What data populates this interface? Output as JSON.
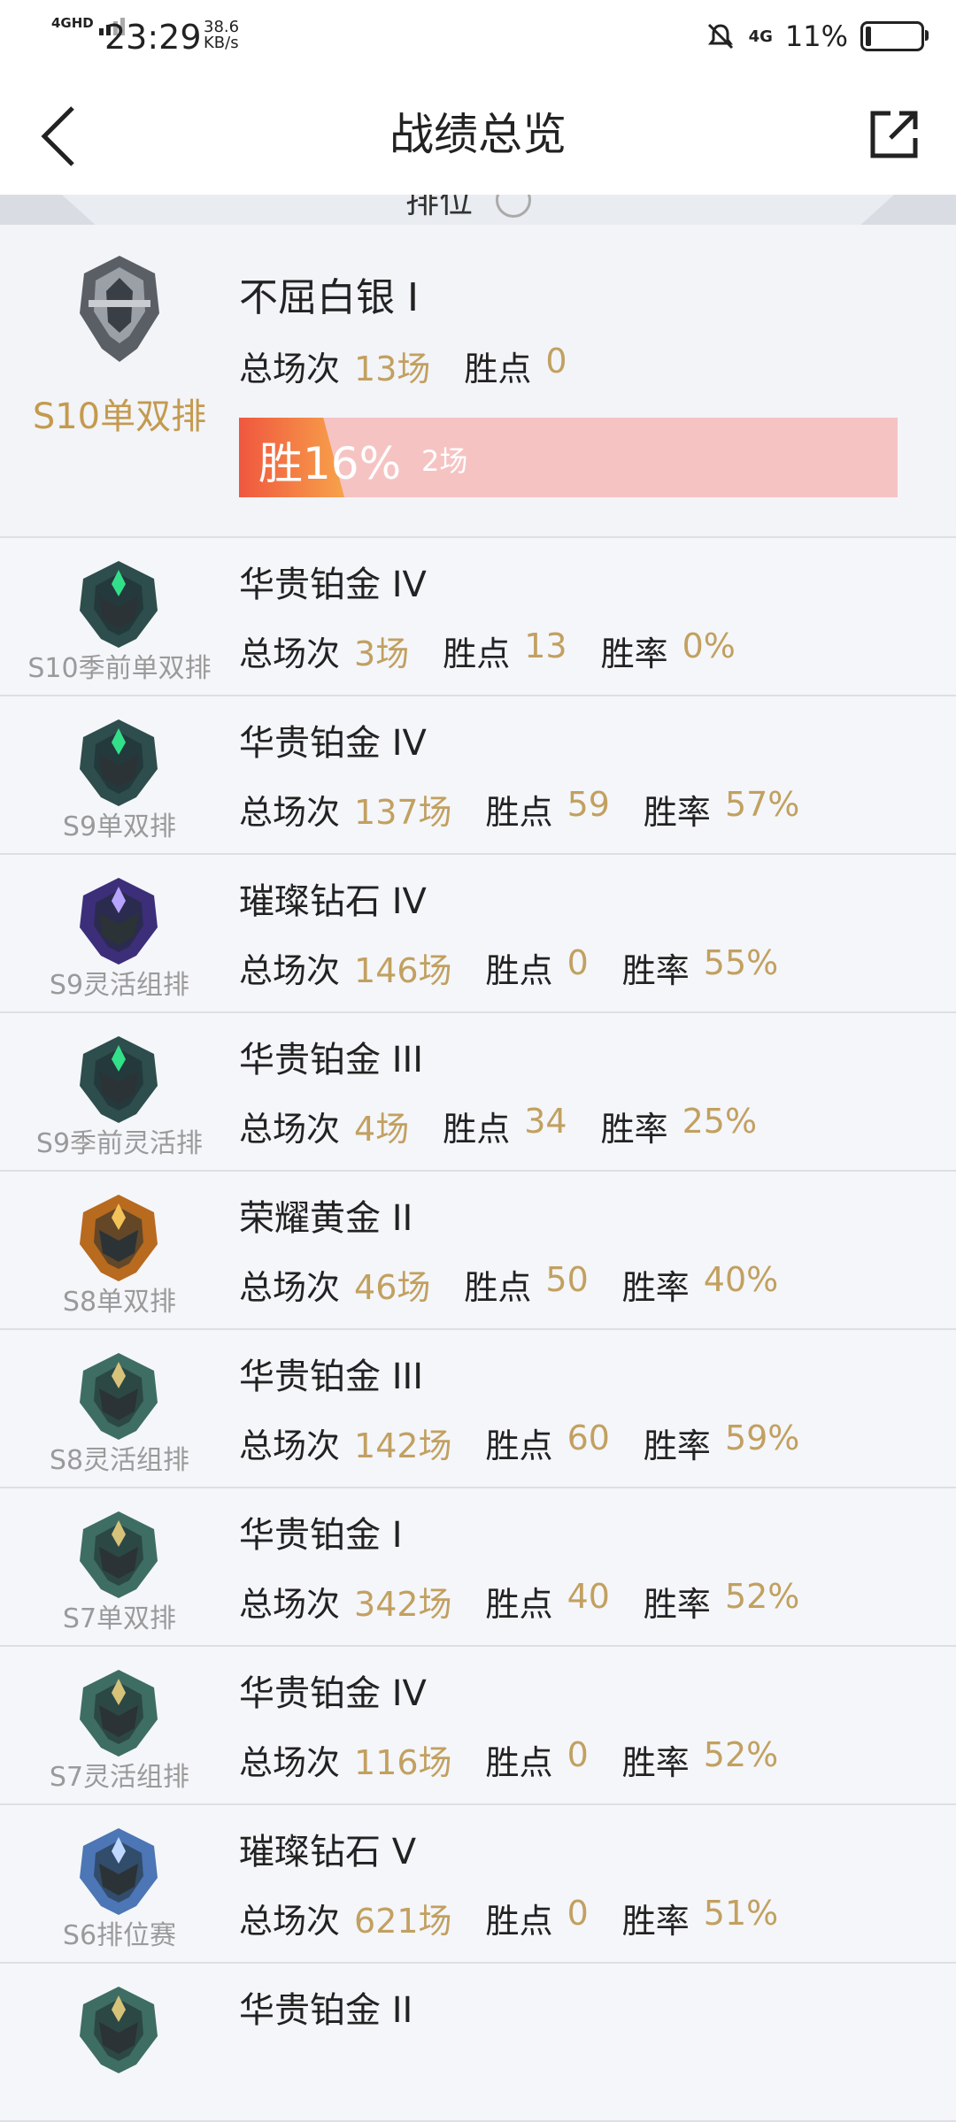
{
  "status_bar": {
    "network": "4GHD",
    "time": "23:29",
    "speed_value": "38.6",
    "speed_unit": "KB/s",
    "network2": "4G",
    "battery": "11%",
    "battery_level": 0.11
  },
  "header": {
    "title": "战绩总览",
    "back_icon": "back-arrow-icon",
    "share_icon": "share-external-icon"
  },
  "tab": {
    "label": "排位"
  },
  "current": {
    "season": "S10单双排",
    "rank": "不屈白银 I",
    "total_label": "总场次",
    "total_value": "13场",
    "lp_label": "胜点",
    "lp_value": "0",
    "win_text": "胜16%",
    "win_games": "2场",
    "win_rate": 0.16,
    "emblem_color": "#5a5f66"
  },
  "seasons": [
    {
      "season": "S10季前单双排",
      "rank": "华贵铂金 IV",
      "total_label": "总场次",
      "total": "3场",
      "lp_label": "胜点",
      "lp": "13",
      "rate_label": "胜率",
      "rate": "0%",
      "emblem": "#2e4d4d",
      "glow": "#32e08a"
    },
    {
      "season": "S9单双排",
      "rank": "华贵铂金 IV",
      "total_label": "总场次",
      "total": "137场",
      "lp_label": "胜点",
      "lp": "59",
      "rate_label": "胜率",
      "rate": "57%",
      "emblem": "#2e4d4d",
      "glow": "#32e08a"
    },
    {
      "season": "S9灵活组排",
      "rank": "璀璨钻石 IV",
      "total_label": "总场次",
      "total": "146场",
      "lp_label": "胜点",
      "lp": "0",
      "rate_label": "胜率",
      "rate": "55%",
      "emblem": "#3d2e7a",
      "glow": "#b7a4ff"
    },
    {
      "season": "S9季前灵活排",
      "rank": "华贵铂金 III",
      "total_label": "总场次",
      "total": "4场",
      "lp_label": "胜点",
      "lp": "34",
      "rate_label": "胜率",
      "rate": "25%",
      "emblem": "#2e4d4d",
      "glow": "#32e08a"
    },
    {
      "season": "S8单双排",
      "rank": "荣耀黄金 II",
      "total_label": "总场次",
      "total": "46场",
      "lp_label": "胜点",
      "lp": "50",
      "rate_label": "胜率",
      "rate": "40%",
      "emblem": "#b86a1f",
      "glow": "#f3c35a"
    },
    {
      "season": "S8灵活组排",
      "rank": "华贵铂金 III",
      "total_label": "总场次",
      "total": "142场",
      "lp_label": "胜点",
      "lp": "60",
      "rate_label": "胜率",
      "rate": "59%",
      "emblem": "#3e6d63",
      "glow": "#d7c27a"
    },
    {
      "season": "S7单双排",
      "rank": "华贵铂金 I",
      "total_label": "总场次",
      "total": "342场",
      "lp_label": "胜点",
      "lp": "40",
      "rate_label": "胜率",
      "rate": "52%",
      "emblem": "#3e6d63",
      "glow": "#d7c27a"
    },
    {
      "season": "S7灵活组排",
      "rank": "华贵铂金 IV",
      "total_label": "总场次",
      "total": "116场",
      "lp_label": "胜点",
      "lp": "0",
      "rate_label": "胜率",
      "rate": "52%",
      "emblem": "#3e6d63",
      "glow": "#d7c27a"
    },
    {
      "season": "S6排位赛",
      "rank": "璀璨钻石 V",
      "total_label": "总场次",
      "total": "621场",
      "lp_label": "胜点",
      "lp": "0",
      "rate_label": "胜率",
      "rate": "51%",
      "emblem": "#4c76b5",
      "glow": "#bfd8ff"
    },
    {
      "season": "",
      "rank": "华贵铂金 II",
      "total_label": "",
      "total": "",
      "lp_label": "",
      "lp": "",
      "rate_label": "",
      "rate": "",
      "emblem": "#3e6d63",
      "glow": "#d7c27a"
    }
  ]
}
